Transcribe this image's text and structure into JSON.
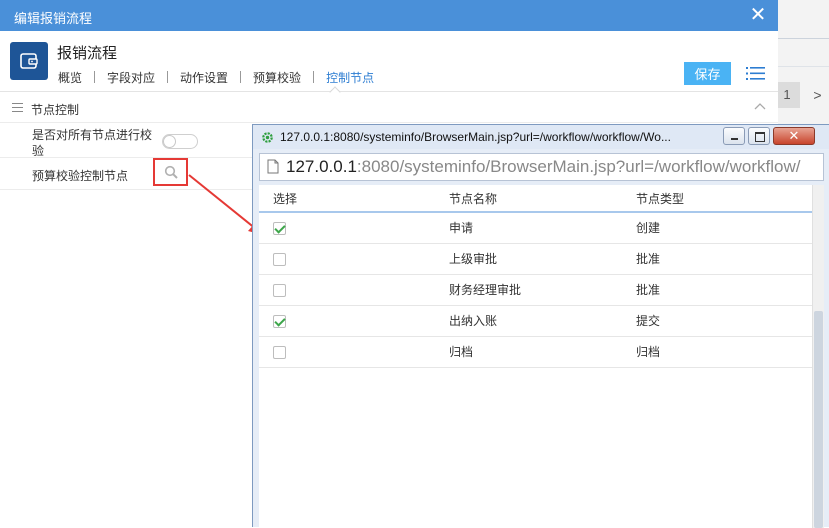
{
  "dialog": {
    "title": "编辑报销流程",
    "close_glyph": "✕",
    "app_title": "报销流程",
    "tabs": [
      {
        "label": "概览",
        "active": false
      },
      {
        "label": "字段对应",
        "active": false
      },
      {
        "label": "动作设置",
        "active": false
      },
      {
        "label": "预算校验",
        "active": false
      },
      {
        "label": "控制节点",
        "active": true
      }
    ],
    "save_label": "保存",
    "section_label": "节点控制",
    "fields": {
      "check_all_nodes_label": "是否对所有节点进行校验",
      "check_all_nodes_value": false,
      "control_node_label": "预算校验控制节点"
    }
  },
  "background": {
    "pager_current": "1",
    "pager_next": ">"
  },
  "popup": {
    "title": "127.0.0.1:8080/systeminfo/BrowserMain.jsp?url=/workflow/workflow/Wo...",
    "address_host": "127.0.0.1",
    "address_rest": ":8080/systeminfo/BrowserMain.jsp?url=/workflow/workflow/",
    "close_glyph": "✕",
    "columns": [
      "选择",
      "节点名称",
      "节点类型"
    ],
    "rows": [
      {
        "checked": true,
        "name": "申请",
        "type": "创建"
      },
      {
        "checked": false,
        "name": "上级审批",
        "type": "批准"
      },
      {
        "checked": false,
        "name": "财务经理审批",
        "type": "批准"
      },
      {
        "checked": true,
        "name": "出纳入账",
        "type": "提交"
      },
      {
        "checked": false,
        "name": "归档",
        "type": "归档"
      }
    ]
  },
  "colors": {
    "titlebar": "#4a90d9",
    "accent": "#2d7dd2",
    "save_button": "#4ab3f4",
    "highlight_box": "#e53935",
    "check_green": "#3da64a"
  },
  "icons": {
    "app_logo": "wallet-icon",
    "menu": "list-menu-icon",
    "browse": "search-icon",
    "favicon": "gear-favicon-icon",
    "page": "page-icon"
  }
}
